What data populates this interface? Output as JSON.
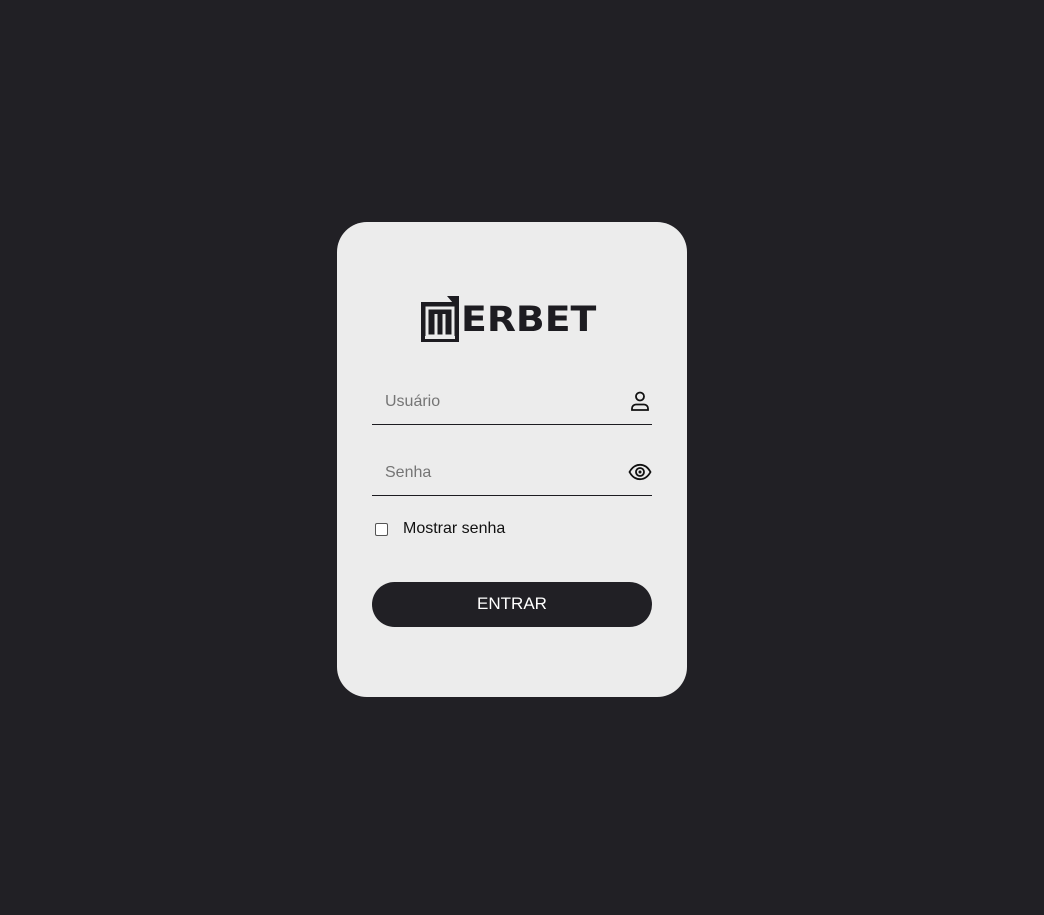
{
  "brand": {
    "logo_text": "ERBET",
    "logo_mark": "W"
  },
  "form": {
    "username": {
      "placeholder": "Usuário",
      "value": "",
      "icon": "user-icon"
    },
    "password": {
      "placeholder": "Senha",
      "value": "",
      "icon": "eye-icon"
    },
    "show_password": {
      "label": "Mostrar senha",
      "checked": false
    },
    "submit_label": "ENTRAR"
  },
  "colors": {
    "background": "#212025",
    "card": "#ececec",
    "accent": "#212025",
    "button_text": "#ffffff"
  }
}
